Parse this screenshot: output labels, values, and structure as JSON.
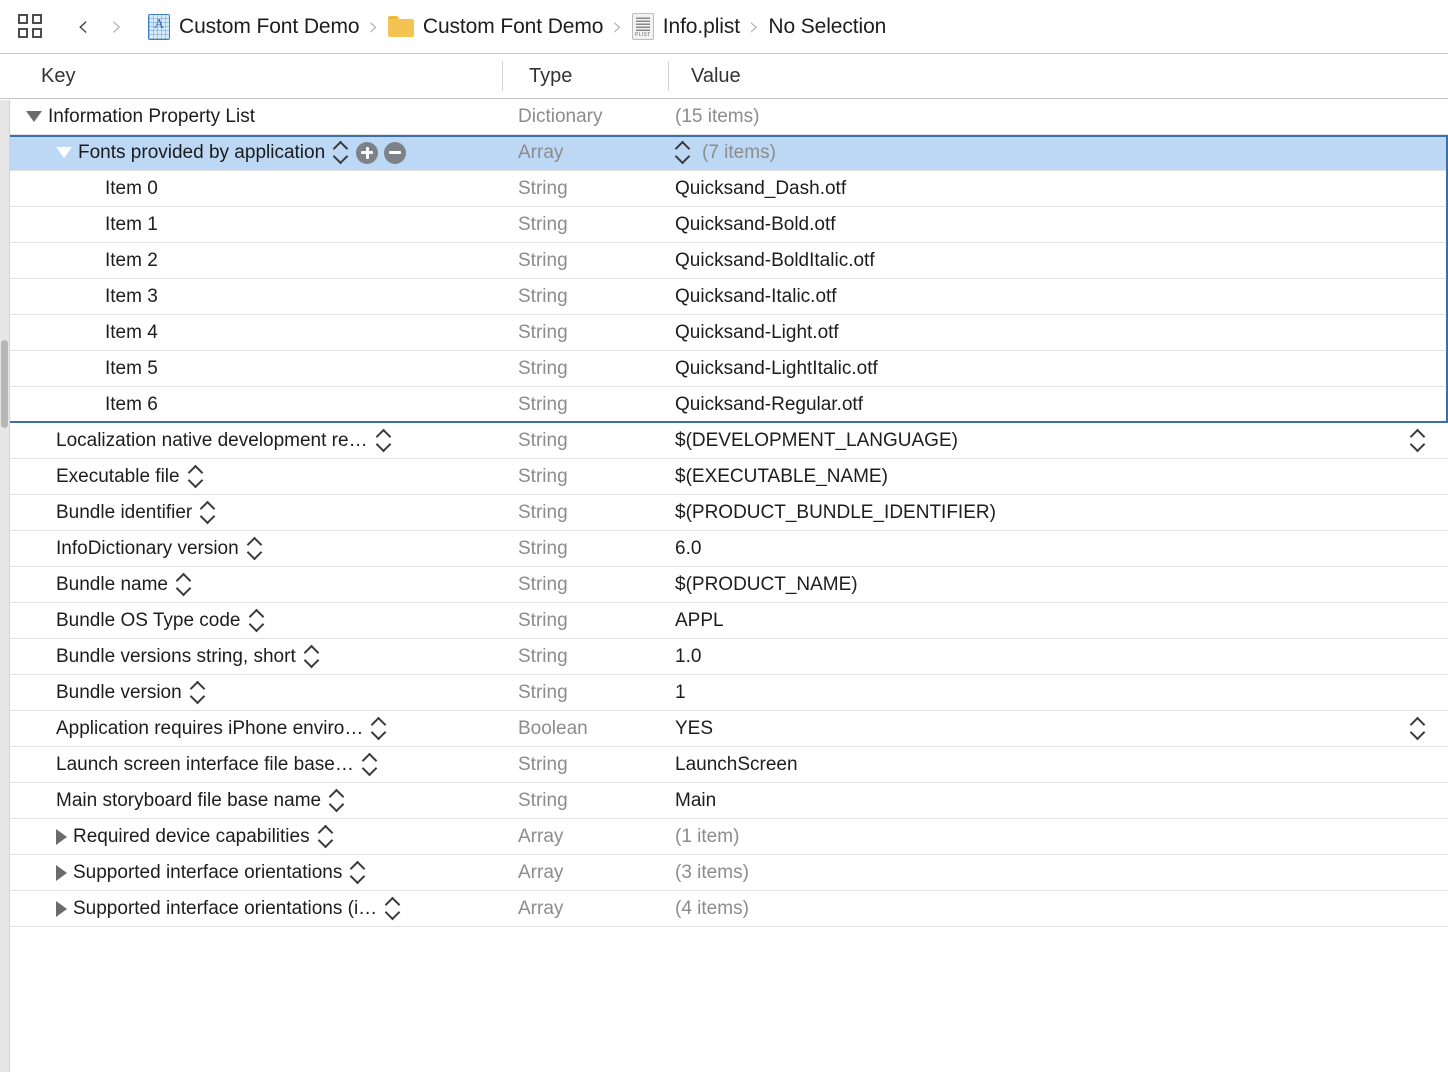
{
  "jumpbar": {
    "panel_toggle": "grid-icon",
    "back_label": "‹",
    "forward_label": "›",
    "separator": "›",
    "crumbs": [
      {
        "label": "Custom Font Demo",
        "icon": "app-blueprint-icon"
      },
      {
        "label": "Custom Font Demo",
        "icon": "folder-icon"
      },
      {
        "label": "Info.plist",
        "icon": "plist-document-icon"
      },
      {
        "label": "No Selection",
        "icon": "none"
      }
    ],
    "plist_icon_tag": "PLIST"
  },
  "table": {
    "columns": {
      "key": "Key",
      "type": "Type",
      "value": "Value"
    },
    "rows": [
      {
        "key": "Information Property List",
        "type": "Dictionary",
        "value": "(15 items)",
        "indent": 0,
        "disclosure": "open",
        "muted_value": true,
        "selected": false,
        "stepper": false,
        "value_stepper": false
      },
      {
        "key": "Fonts provided by application",
        "type": "Array",
        "value": "(7 items)",
        "indent": 1,
        "disclosure": "open",
        "muted_value": true,
        "selected": true,
        "stepper": true,
        "addremove": true,
        "value_stepper": true
      },
      {
        "key": "Item 0",
        "type": "String",
        "value": "Quicksand_Dash.otf",
        "indent": 2,
        "disclosure": "none",
        "muted_value": false,
        "selected": false,
        "stepper": false,
        "value_stepper": false
      },
      {
        "key": "Item 1",
        "type": "String",
        "value": "Quicksand-Bold.otf",
        "indent": 2,
        "disclosure": "none",
        "muted_value": false,
        "selected": false,
        "stepper": false,
        "value_stepper": false
      },
      {
        "key": "Item 2",
        "type": "String",
        "value": "Quicksand-BoldItalic.otf",
        "indent": 2,
        "disclosure": "none",
        "muted_value": false,
        "selected": false,
        "stepper": false,
        "value_stepper": false
      },
      {
        "key": "Item 3",
        "type": "String",
        "value": "Quicksand-Italic.otf",
        "indent": 2,
        "disclosure": "none",
        "muted_value": false,
        "selected": false,
        "stepper": false,
        "value_stepper": false
      },
      {
        "key": "Item 4",
        "type": "String",
        "value": "Quicksand-Light.otf",
        "indent": 2,
        "disclosure": "none",
        "muted_value": false,
        "selected": false,
        "stepper": false,
        "value_stepper": false
      },
      {
        "key": "Item 5",
        "type": "String",
        "value": "Quicksand-LightItalic.otf",
        "indent": 2,
        "disclosure": "none",
        "muted_value": false,
        "selected": false,
        "stepper": false,
        "value_stepper": false
      },
      {
        "key": "Item 6",
        "type": "String",
        "value": "Quicksand-Regular.otf",
        "indent": 2,
        "disclosure": "none",
        "muted_value": false,
        "selected": false,
        "stepper": false,
        "value_stepper": false
      },
      {
        "key": "Localization native development re…",
        "type": "String",
        "value": "$(DEVELOPMENT_LANGUAGE)",
        "indent": 1,
        "disclosure": "none",
        "muted_value": false,
        "selected": false,
        "stepper": true,
        "value_stepper": true
      },
      {
        "key": "Executable file",
        "type": "String",
        "value": "$(EXECUTABLE_NAME)",
        "indent": 1,
        "disclosure": "none",
        "muted_value": false,
        "selected": false,
        "stepper": true,
        "value_stepper": false
      },
      {
        "key": "Bundle identifier",
        "type": "String",
        "value": "$(PRODUCT_BUNDLE_IDENTIFIER)",
        "indent": 1,
        "disclosure": "none",
        "muted_value": false,
        "selected": false,
        "stepper": true,
        "value_stepper": false
      },
      {
        "key": "InfoDictionary version",
        "type": "String",
        "value": "6.0",
        "indent": 1,
        "disclosure": "none",
        "muted_value": false,
        "selected": false,
        "stepper": true,
        "value_stepper": false
      },
      {
        "key": "Bundle name",
        "type": "String",
        "value": "$(PRODUCT_NAME)",
        "indent": 1,
        "disclosure": "none",
        "muted_value": false,
        "selected": false,
        "stepper": true,
        "value_stepper": false
      },
      {
        "key": "Bundle OS Type code",
        "type": "String",
        "value": "APPL",
        "indent": 1,
        "disclosure": "none",
        "muted_value": false,
        "selected": false,
        "stepper": true,
        "value_stepper": false
      },
      {
        "key": "Bundle versions string, short",
        "type": "String",
        "value": "1.0",
        "indent": 1,
        "disclosure": "none",
        "muted_value": false,
        "selected": false,
        "stepper": true,
        "value_stepper": false
      },
      {
        "key": "Bundle version",
        "type": "String",
        "value": "1",
        "indent": 1,
        "disclosure": "none",
        "muted_value": false,
        "selected": false,
        "stepper": true,
        "value_stepper": false
      },
      {
        "key": "Application requires iPhone enviro…",
        "type": "Boolean",
        "value": "YES",
        "indent": 1,
        "disclosure": "none",
        "muted_value": false,
        "selected": false,
        "stepper": true,
        "value_stepper": true
      },
      {
        "key": "Launch screen interface file base…",
        "type": "String",
        "value": "LaunchScreen",
        "indent": 1,
        "disclosure": "none",
        "muted_value": false,
        "selected": false,
        "stepper": true,
        "value_stepper": false
      },
      {
        "key": "Main storyboard file base name",
        "type": "String",
        "value": "Main",
        "indent": 1,
        "disclosure": "none",
        "muted_value": false,
        "selected": false,
        "stepper": true,
        "value_stepper": false
      },
      {
        "key": "Required device capabilities",
        "type": "Array",
        "value": "(1 item)",
        "indent": 1,
        "disclosure": "closed",
        "muted_value": true,
        "selected": false,
        "stepper": true,
        "value_stepper": false
      },
      {
        "key": "Supported interface orientations",
        "type": "Array",
        "value": "(3 items)",
        "indent": 1,
        "disclosure": "closed",
        "muted_value": true,
        "selected": false,
        "stepper": true,
        "value_stepper": false
      },
      {
        "key": "Supported interface orientations (i…",
        "type": "Array",
        "value": "(4 items)",
        "indent": 1,
        "disclosure": "closed",
        "muted_value": true,
        "selected": false,
        "stepper": true,
        "value_stepper": false
      }
    ]
  },
  "colors": {
    "selection_bg": "#bdd8f5",
    "focus_ring": "#3b6fab",
    "type_text": "#8c8c8c",
    "row_separator": "#e3e3e3",
    "stepper_button": "#7d8288"
  }
}
